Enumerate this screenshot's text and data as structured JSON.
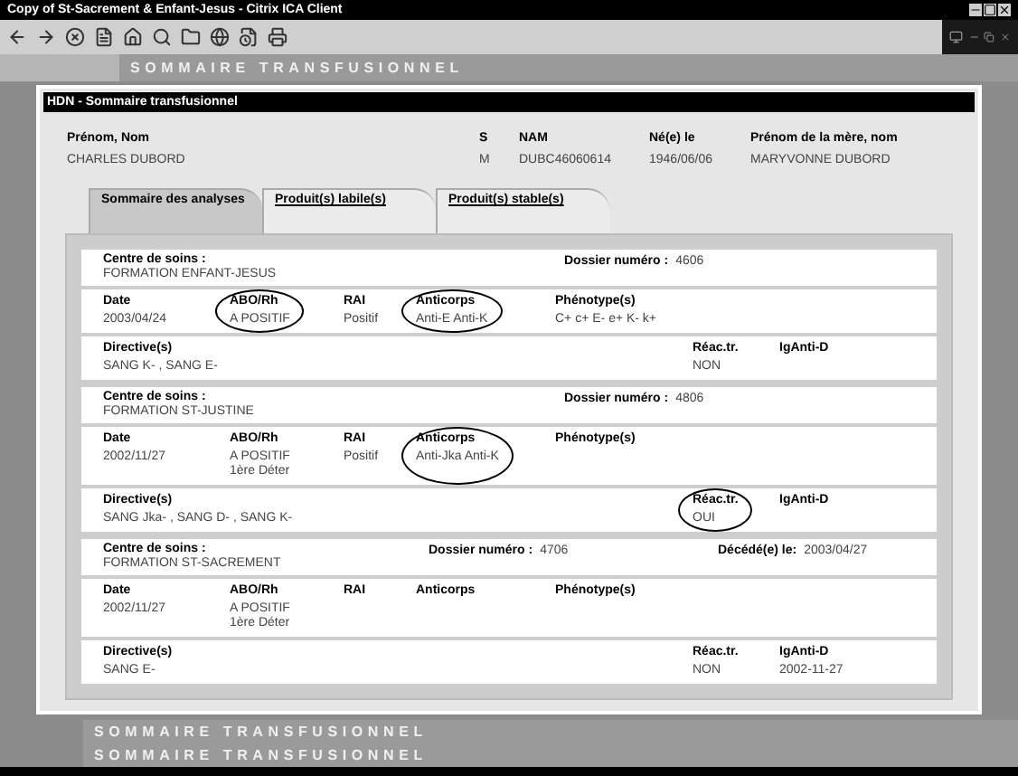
{
  "window": {
    "title": "Copy of St-Sacrement & Enfant-Jesus - Citrix ICA Client"
  },
  "banner": "SOMMAIRE TRANSFUSIONNEL",
  "dialog": {
    "title": "HDN - Sommaire transfusionnel"
  },
  "patient": [
    {
      "label": "Prénom, Nom",
      "value": "CHARLES DUBORD"
    },
    {
      "label": "S",
      "value": "M"
    },
    {
      "label": "NAM",
      "value": "DUBC46060614"
    },
    {
      "label": "Né(e) le",
      "value": "1946/06/06"
    },
    {
      "label": "Prénom de la mère, nom",
      "value": "MARYVONNE DUBORD"
    }
  ],
  "tabs": [
    {
      "label": "Sommaire des analyses",
      "selected": true
    },
    {
      "label": "Produit(s) labile(s)",
      "selected": false
    },
    {
      "label": "Produit(s) stable(s)",
      "selected": false
    }
  ],
  "records": [
    {
      "centre_label": "Centre de soins :",
      "centre": "FORMATION ENFANT-JESUS",
      "dossier_label": "Dossier numéro :",
      "dossier": "4606",
      "analysis": [
        {
          "header": "Date",
          "value": [
            "2003/04/24"
          ],
          "circled": false
        },
        {
          "header": "ABO/Rh",
          "value": [
            "A POSITIF"
          ],
          "circled": true
        },
        {
          "header": "RAI",
          "value": [
            "Positif"
          ],
          "circled": false
        },
        {
          "header": "Anticorps",
          "value": [
            "Anti-E Anti-K"
          ],
          "circled": true
        },
        {
          "header": "Phénotype(s)",
          "value": [
            "C+ c+ E- e+ K- k+"
          ],
          "circled": false
        }
      ],
      "directives": [
        {
          "header": "Directive(s)",
          "value": "SANG K- ,  SANG E-",
          "circled": false
        },
        {
          "header": "Réac.tr.",
          "value": "NON",
          "circled": false
        },
        {
          "header": "IgAnti-D",
          "circled": false
        }
      ]
    },
    {
      "centre_label": "Centre de soins :",
      "centre": "FORMATION ST-JUSTINE",
      "dossier_label": "Dossier numéro :",
      "dossier": "4806",
      "analysis": [
        {
          "header": "Date",
          "value": [
            "2002/11/27"
          ],
          "circled": false
        },
        {
          "header": "ABO/Rh",
          "value": [
            "A POSITIF",
            "1ère Déter"
          ],
          "circled": false
        },
        {
          "header": "RAI",
          "value": [
            "Positif"
          ],
          "circled": false
        },
        {
          "header": "Anticorps",
          "value": [
            "Anti-Jka Anti-K"
          ],
          "circled": true
        },
        {
          "header": "Phénotype(s)",
          "circled": false
        }
      ],
      "directives": [
        {
          "header": "Directive(s)",
          "value": "SANG Jka- ,  SANG D- ,  SANG K-",
          "circled": false
        },
        {
          "header": "Réac.tr.",
          "value": "OUI",
          "circled": true
        },
        {
          "header": "IgAnti-D",
          "circled": false
        }
      ]
    },
    {
      "centre_label": "Centre de soins :",
      "centre": "FORMATION ST-SACREMENT",
      "dossier_label": "Dossier numéro :",
      "dossier": "4706",
      "death": {
        "label": "Décédé(e) le:",
        "value": "2003/04/27"
      },
      "analysis": [
        {
          "header": "Date",
          "value": [
            "2002/11/27"
          ],
          "circled": false
        },
        {
          "header": "ABO/Rh",
          "value": [
            "A POSITIF",
            "1ère Déter"
          ],
          "circled": false
        },
        {
          "header": "RAI",
          "circled": false
        },
        {
          "header": "Anticorps",
          "circled": false
        },
        {
          "header": "Phénotype(s)",
          "circled": false
        }
      ],
      "directives": [
        {
          "header": "Directive(s)",
          "value": "SANG E-",
          "circled": false
        },
        {
          "header": "Réac.tr.",
          "value": "NON",
          "circled": false
        },
        {
          "header": "IgAnti-D",
          "value": "2002-11-27",
          "circled": false
        }
      ]
    }
  ],
  "footer_banners": [
    "SOMMAIRE TRANSFUSIONNEL",
    "SOMMAIRE TRANSFUSIONNEL"
  ]
}
